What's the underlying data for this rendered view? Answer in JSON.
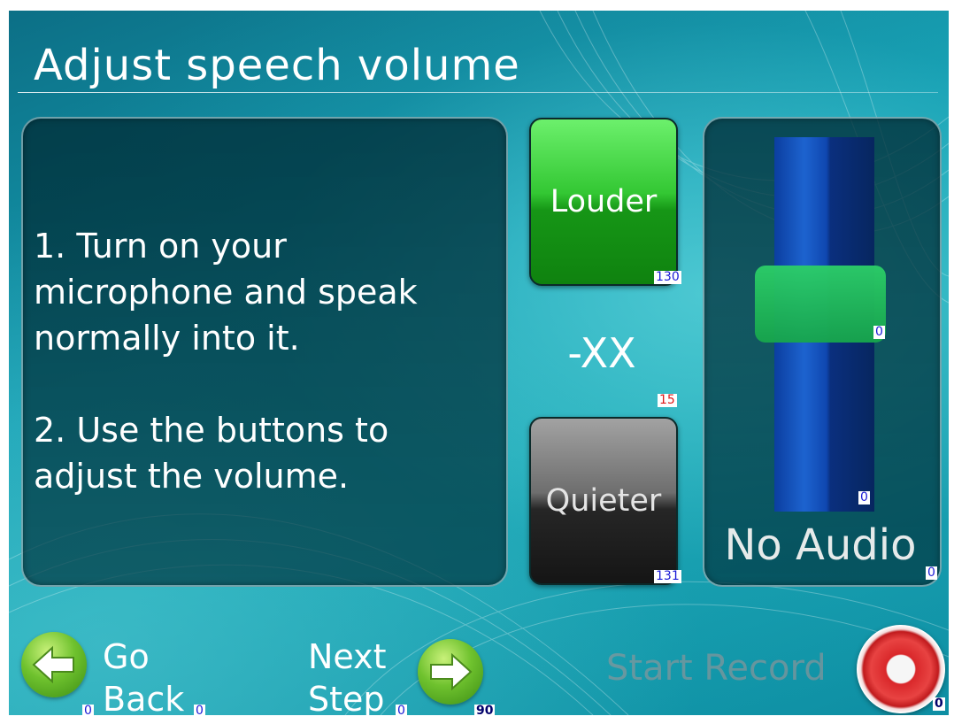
{
  "title": "Adjust speech volume",
  "instructions": "1. Turn on your\nmicrophone and speak\nnormally into it.\n\n2. Use the buttons to\nadjust the volume.",
  "controls": {
    "louder_label": "Louder",
    "quieter_label": "Quieter",
    "volume_value": "-XX"
  },
  "meter": {
    "status_label": "No Audio"
  },
  "nav": {
    "back_line1": "Go",
    "back_line2": "Back",
    "next_line1": "Next",
    "next_line2": "Step"
  },
  "record": {
    "label": "Start Record"
  },
  "debug_tags": {
    "louder": "130",
    "volume": "15",
    "quieter": "131",
    "meter_handle": "0",
    "meter_bottom": "0",
    "meter_label": "0",
    "back_icon": "0",
    "back_text": "0",
    "next_text": "0",
    "next_icon": "90",
    "record": "0"
  },
  "colors": {
    "background": "#15a0b3",
    "louder": "#1fae1f",
    "quieter": "#2a2a2a",
    "meter_track": "#1d63cf",
    "meter_handle": "#22b85a",
    "record": "#d9272a"
  }
}
